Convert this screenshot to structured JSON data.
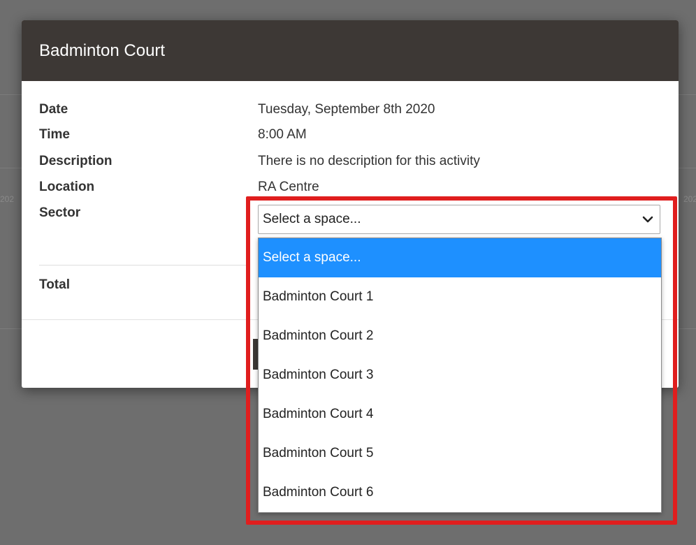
{
  "background": {
    "left_fragment": "202",
    "right_fragment": "202"
  },
  "modal": {
    "title": "Badminton Court",
    "details": [
      {
        "label": "Date",
        "value": "Tuesday, September 8th 2020"
      },
      {
        "label": "Time",
        "value": "8:00 AM"
      },
      {
        "label": "Description",
        "value": "There is no description for this activity"
      },
      {
        "label": "Location",
        "value": "RA Centre"
      }
    ],
    "sector_label": "Sector",
    "total_label": "Total",
    "select": {
      "selected_value": "Select a space...",
      "options": [
        "Select a space...",
        "Badminton Court 1",
        "Badminton Court 2",
        "Badminton Court 3",
        "Badminton Court 4",
        "Badminton Court 5",
        "Badminton Court 6"
      ],
      "highlighted_index": 0
    }
  },
  "colors": {
    "header_bg": "#3d3835",
    "option_highlight": "#1e90ff",
    "annotation_red": "#e01e1e",
    "overlay": "#6e6e6e"
  },
  "icons": {
    "select_arrow": "chevron-down-icon"
  }
}
